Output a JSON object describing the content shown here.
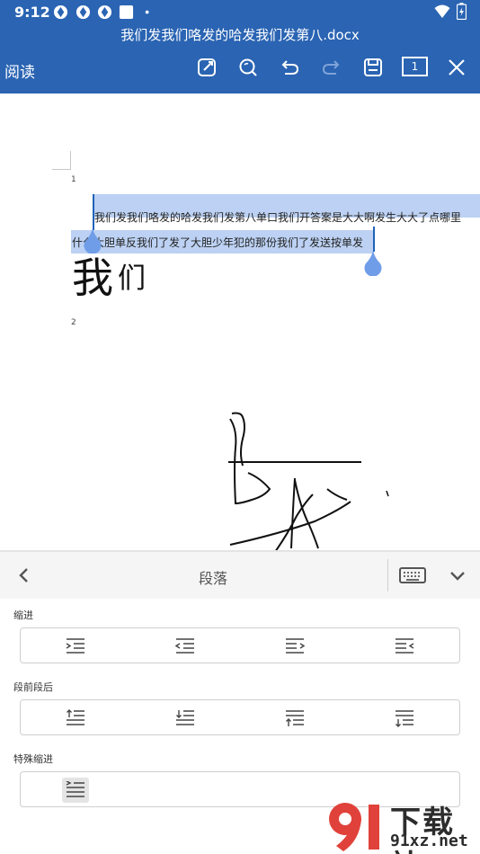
{
  "status_bar": {
    "time": "9:12",
    "notification_icons": [
      "aperture-icon",
      "aperture-icon",
      "aperture-icon",
      "square-icon",
      "dot-icon"
    ],
    "right_icons": [
      "wifi-icon",
      "battery-icon"
    ]
  },
  "header": {
    "doc_title": "我们发我们咯发的哈发我们发第八.docx",
    "read_mode_label": "阅读",
    "toolbar_icons": [
      "edit-icon",
      "search-icon",
      "undo-icon",
      "redo-icon",
      "save-icon",
      "page-count-icon",
      "close-icon"
    ],
    "page_count": "1"
  },
  "document": {
    "page_number_1": "1",
    "page_number_2": "2",
    "line_1": "我们发我们咯发的哈发我们发第八单口我们开答案是大大啊发生大大了点哪里",
    "line_2": "什么大胆单反我们了发了大胆少年犯的那份我们了发送按单发",
    "big_text": "我",
    "small_text": "们"
  },
  "panel": {
    "title": "段落",
    "back_icon": "chevron-left-icon",
    "keyboard_icon": "keyboard-icon",
    "collapse_icon": "chevron-down-icon",
    "sections": {
      "indent": {
        "label": "缩进",
        "buttons": [
          "increase-indent-icon",
          "decrease-indent-icon",
          "right-indent-icon",
          "left-indent-icon"
        ]
      },
      "spacing": {
        "label": "段前段后",
        "buttons": [
          "space-before-increase-icon",
          "space-after-increase-icon",
          "space-before-decrease-icon",
          "space-after-decrease-icon"
        ]
      },
      "special": {
        "label": "特殊缩进",
        "buttons": [
          "first-line-indent-icon"
        ]
      }
    }
  },
  "watermark": {
    "brand": "下载站",
    "url": "91xz.net"
  },
  "colors": {
    "header_bg": "#2a64b3",
    "selection": "#bcd1f3",
    "handle": "#6f9de8"
  }
}
